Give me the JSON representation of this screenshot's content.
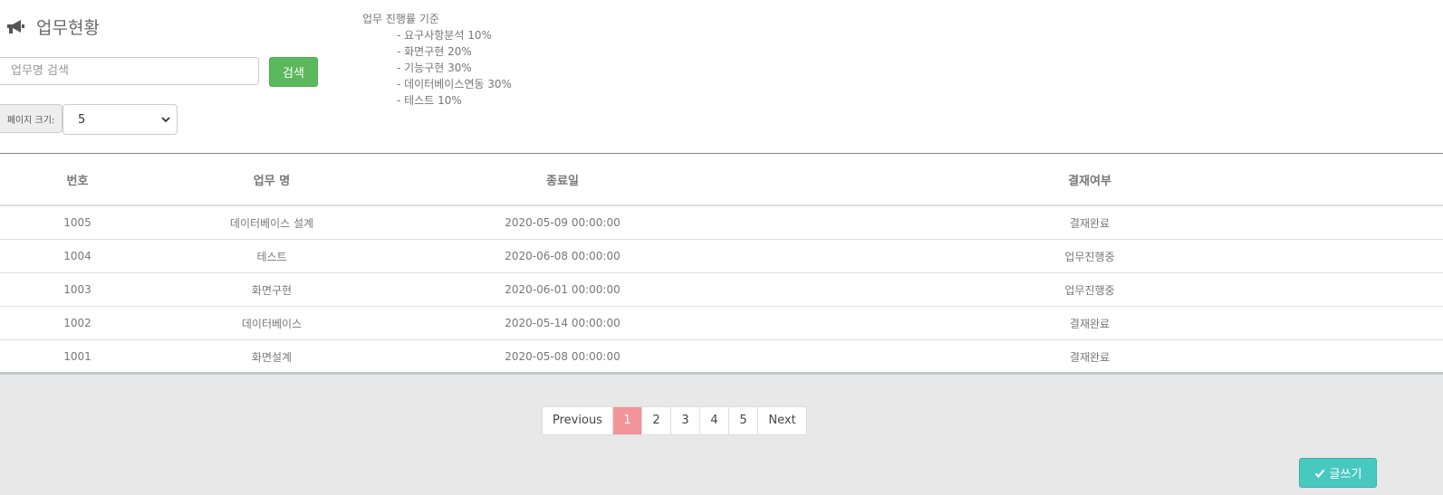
{
  "header": {
    "title": "업무현황",
    "title_icon": "megaphone-icon"
  },
  "search": {
    "placeholder": "업무명 검색",
    "value": "",
    "button_label": "검색"
  },
  "page_size": {
    "label": "페이지 크기:",
    "selected": "5"
  },
  "criteria": {
    "heading": "업무 진행률 기준",
    "items": [
      "- 요구사항분석 10%",
      "- 화면구현 20%",
      "- 기능구현 30%",
      "- 데이터베이스연동 30%",
      "- 테스트 10%"
    ]
  },
  "table": {
    "columns": [
      "번호",
      "업무 명",
      "종료일",
      "결재여부"
    ],
    "rows": [
      [
        "1005",
        "데이터베이스 설계",
        "2020-05-09 00:00:00",
        "결재완료"
      ],
      [
        "1004",
        "테스트",
        "2020-06-08 00:00:00",
        "업무진행중"
      ],
      [
        "1003",
        "화면구현",
        "2020-06-01 00:00:00",
        "업무진행중"
      ],
      [
        "1002",
        "데이터베이스",
        "2020-05-14 00:00:00",
        "결재완료"
      ],
      [
        "1001",
        "화면설계",
        "2020-05-08 00:00:00",
        "결재완료"
      ]
    ]
  },
  "pagination": {
    "previous": "Previous",
    "pages": [
      "1",
      "2",
      "3",
      "4",
      "5"
    ],
    "active": "1",
    "next": "Next"
  },
  "write_button": {
    "label": "글쓰기",
    "icon": "check-icon"
  },
  "colors": {
    "search_button": "#5cb85c",
    "active_page": "#f2959a",
    "write_button": "#48c9c0"
  }
}
